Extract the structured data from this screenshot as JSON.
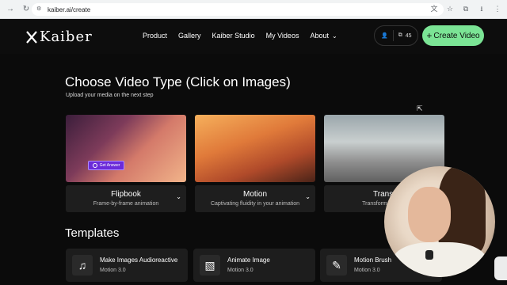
{
  "browser": {
    "url": "kaiber.ai/create",
    "icons": [
      "back-icon",
      "reload-icon",
      "translate-icon",
      "star-icon",
      "extensions-icon",
      "download-icon",
      "menu-icon"
    ]
  },
  "header": {
    "logo_text": "Kaiber",
    "nav": [
      {
        "label": "Product"
      },
      {
        "label": "Gallery"
      },
      {
        "label": "Kaiber Studio"
      },
      {
        "label": "My Videos"
      },
      {
        "label": "About"
      }
    ],
    "credits": "45",
    "create_button": "Create Video",
    "accent_color": "#7be495"
  },
  "main": {
    "title": "Choose Video Type (Click on Images)",
    "subtitle": "Upload your media on the next step",
    "types": [
      {
        "name": "Flipbook",
        "desc": "Frame-by-frame animation"
      },
      {
        "name": "Motion",
        "desc": "Captivating fluidity in your animation"
      },
      {
        "name": "Transf",
        "desc": "Transform an exis"
      }
    ],
    "overlay_button": "Get Answer"
  },
  "templates": {
    "title": "Templates",
    "items": [
      {
        "name": "Make Images Audioreactive",
        "sub": "Motion 3.0",
        "icon": "music-note-icon"
      },
      {
        "name": "Animate Image",
        "sub": "Motion 3.0",
        "icon": "image-icon"
      },
      {
        "name": "Motion Brush",
        "sub": "Motion 3.0",
        "icon": "brush-icon"
      }
    ]
  }
}
